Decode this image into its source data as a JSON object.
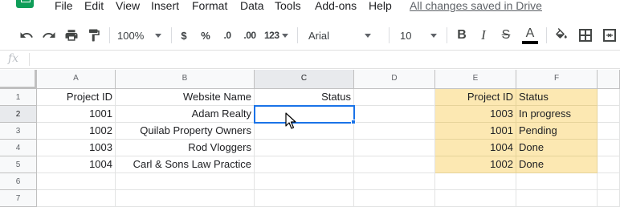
{
  "menu": {
    "items": [
      "File",
      "Edit",
      "View",
      "Insert",
      "Format",
      "Data",
      "Tools",
      "Add-ons",
      "Help"
    ],
    "save_status": "All changes saved in Drive"
  },
  "toolbar": {
    "zoom": "100%",
    "currency": "$",
    "percent": "%",
    "decrease_decimals": ".0",
    "increase_decimals": ".00",
    "more_formats": "123",
    "font": "Arial",
    "font_size": "10",
    "bold": "B",
    "italic": "I",
    "strikethrough": "S",
    "text_color_letter": "A",
    "text_color": "#000000"
  },
  "formula_bar": {
    "label": "fx",
    "value": ""
  },
  "sheet": {
    "columns": [
      "A",
      "B",
      "C",
      "D",
      "E",
      "F"
    ],
    "rows": [
      "1",
      "2",
      "3",
      "4",
      "5",
      "6",
      "7"
    ],
    "selected_cell": "C2",
    "highlight_color": "#fce8b2",
    "cells": {
      "A1": "Project ID",
      "B1": "Website Name",
      "C1": "Status",
      "A2": "1001",
      "B2": "Adam Realty",
      "A3": "1002",
      "B3": "Quilab Property Owners",
      "A4": "1003",
      "B4": "Rod Vloggers",
      "A5": "1004",
      "B5": "Carl & Sons Law Practice",
      "E1": "Project ID",
      "F1": "Status",
      "E2": "1003",
      "F2": "In progress",
      "E3": "1001",
      "F3": "Pending",
      "E4": "1004",
      "F4": "Done",
      "E5": "1002",
      "F5": "Done"
    }
  }
}
